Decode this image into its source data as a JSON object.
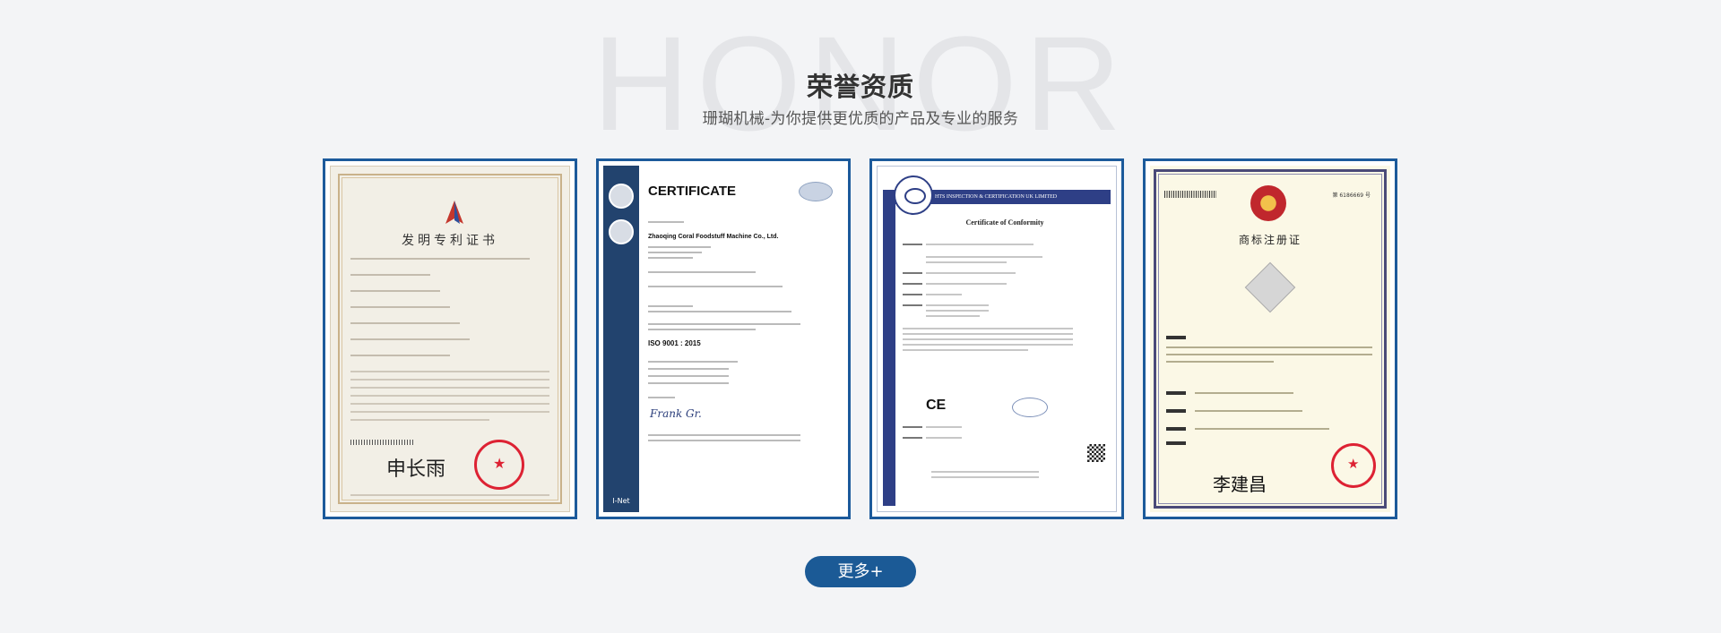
{
  "section": {
    "bg_word": "HONOR",
    "title": "荣誉资质",
    "subtitle": "珊瑚机械-为你提供更优质的产品及专业的服务"
  },
  "certificates": [
    {
      "name": "patent-certificate",
      "title": "发明专利证书",
      "signature": "申长雨"
    },
    {
      "name": "iso-certificate",
      "title": "CERTIFICATE",
      "company": "Zhaoqing Coral Foodstuff Machine Co., Ltd.",
      "standard": "ISO 9001 : 2015",
      "footer": "I-Net"
    },
    {
      "name": "ce-certificate",
      "header": "HTS INSPECTION & CERTIFICATION UK LIMITED",
      "title": "Certificate of Conformity",
      "mark": "CE"
    },
    {
      "name": "trademark-certificate",
      "title": "商标注册证",
      "number": "第 6186669 号",
      "signature": "李建昌"
    }
  ],
  "more_button": {
    "label": "更多+"
  },
  "colors": {
    "accent": "#1b5a96",
    "frame": "#1c5a9b",
    "background": "#f3f4f6"
  }
}
